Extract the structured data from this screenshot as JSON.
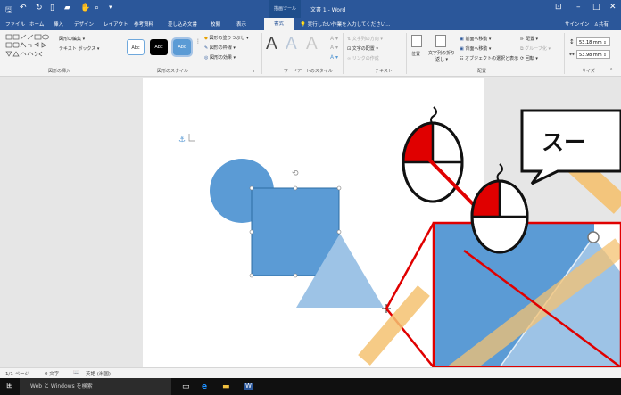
{
  "titlebar": {
    "context_tab_group": "描画ツール",
    "doc_title": "文書 1 - Word",
    "minimize": "–",
    "restore": "□",
    "close": "✕",
    "restore_ribbon": "⊡"
  },
  "tabs": [
    "ファイル",
    "ホーム",
    "挿入",
    "デザイン",
    "レイアウト",
    "参考資料",
    "差し込み文書",
    "校閲",
    "表示",
    "書式"
  ],
  "tellme": "実行したい作業を入力してください...",
  "signin": "サインイン",
  "share": "共有",
  "ribbon": {
    "insert_shapes": {
      "edit_shape": "図形の編集 ▾",
      "text_box": "テキスト ボックス ▾",
      "label": "図形の挿入"
    },
    "shape_styles": {
      "swatch1": "Abc",
      "swatch2": "Abc",
      "swatch3": "Abc",
      "fill": "図形の塗りつぶし ▾",
      "outline": "図形の枠線 ▾",
      "effects": "図形の効果 ▾",
      "label": "図形のスタイル"
    },
    "wordart": {
      "glyph": "A",
      "label": "ワードアートのスタイル"
    },
    "text": {
      "direction": "文字列の方向 ▾",
      "align": "文字の配置 ▾",
      "link": "リンクの作成",
      "label": "テキスト"
    },
    "arrange": {
      "position": "位置",
      "wrap": "文字列の折り返し ▾",
      "forward": "前面へ移動 ▾",
      "backward": "背面へ移動 ▾",
      "selection_pane": "オブジェクトの選択と表示",
      "align": "配置 ▾",
      "group": "グループ化 ▾",
      "rotate": "回転 ▾",
      "label": "配置"
    },
    "size": {
      "height": "53.18 mm",
      "width": "53.98 mm",
      "label": "サイズ"
    }
  },
  "overlay": {
    "speech_bubble": "スー"
  },
  "statusbar": {
    "page": "1/1 ページ",
    "words": "0 文字",
    "language": "英語 (米国)"
  },
  "taskbar": {
    "search_placeholder": "Web と Windows を検索"
  },
  "colors": {
    "word_blue": "#2b579a",
    "shape_blue": "#5b9bd5",
    "red": "#e00000",
    "yellow_line": "#f5c271"
  }
}
